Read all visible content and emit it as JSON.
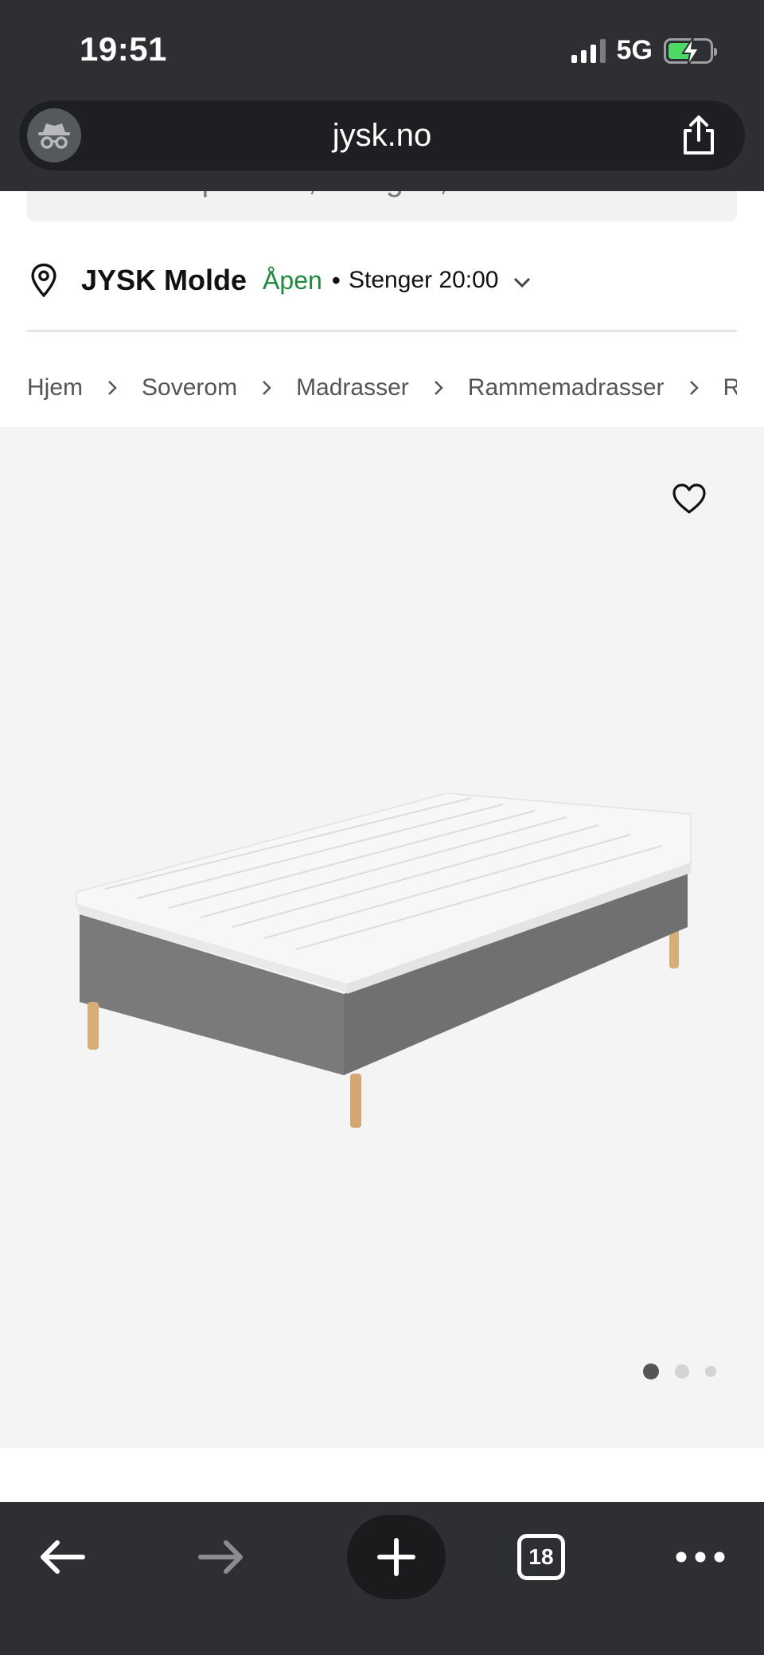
{
  "status_bar": {
    "time": "19:51",
    "network": "5G",
    "battery_color": "#4cd964"
  },
  "browser": {
    "url": "jysk.no",
    "icons": [
      "incognito-icon",
      "share-icon"
    ]
  },
  "search": {
    "placeholder": "Søk etter produkt, kategori, merkevare"
  },
  "store": {
    "name": "JYSK Molde",
    "status": "Åpen",
    "separator": "•",
    "hours": "Stenger 20:00",
    "status_color": "#1e8a3c"
  },
  "breadcrumb": [
    "Hjem",
    "Soverom",
    "Madrasser",
    "Rammemadrasser",
    "Ram"
  ],
  "gallery": {
    "image_count": 3,
    "active_index": 0
  },
  "toolbar": {
    "tab_count": "18"
  }
}
